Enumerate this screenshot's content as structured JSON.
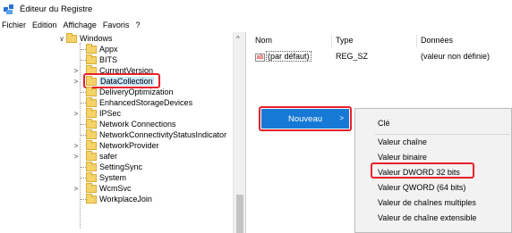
{
  "window": {
    "title": "Éditeur du Registre"
  },
  "menubar": [
    "Fichier",
    "Edition",
    "Affichage",
    "Favoris",
    "?"
  ],
  "tree": {
    "expanders": {
      "windows": "∨",
      "current_version": ">",
      "data_collection": ">",
      "ipsec": ">",
      "network_provider": ">",
      "safer": ">",
      "wcmsvc": ">"
    },
    "items": [
      "Windows",
      "Appx",
      "BITS",
      "CurrentVersion",
      "DataCollection",
      "DeliveryOptimization",
      "EnhancedStorageDevices",
      "IPSec",
      "Network Connections",
      "NetworkConnectivityStatusIndicator",
      "NetworkProvider",
      "safer",
      "SettingSync",
      "System",
      "WcmSvc",
      "WorkplaceJoin"
    ],
    "scroll_up_arrow": "^"
  },
  "list": {
    "columns": [
      "Nom",
      "Type",
      "Données"
    ],
    "rows": [
      {
        "icon_text": "ab",
        "name": "(par défaut)",
        "type": "REG_SZ",
        "data": "(valeur non définie)"
      }
    ]
  },
  "context_menu": {
    "nouveau_label": "Nouveau",
    "arrow": ">"
  },
  "submenu": {
    "items": [
      "Clé",
      "Valeur chaîne",
      "Valeur binaire",
      "Valeur DWORD 32 bits",
      "Valeur QWORD (64 bits)",
      "Valeur de chaînes multiples",
      "Valeur de chaîne extensible"
    ]
  },
  "colors": {
    "highlight": "#e8202a",
    "menu_accent": "#1679d6",
    "selection": "#cce8ff"
  }
}
